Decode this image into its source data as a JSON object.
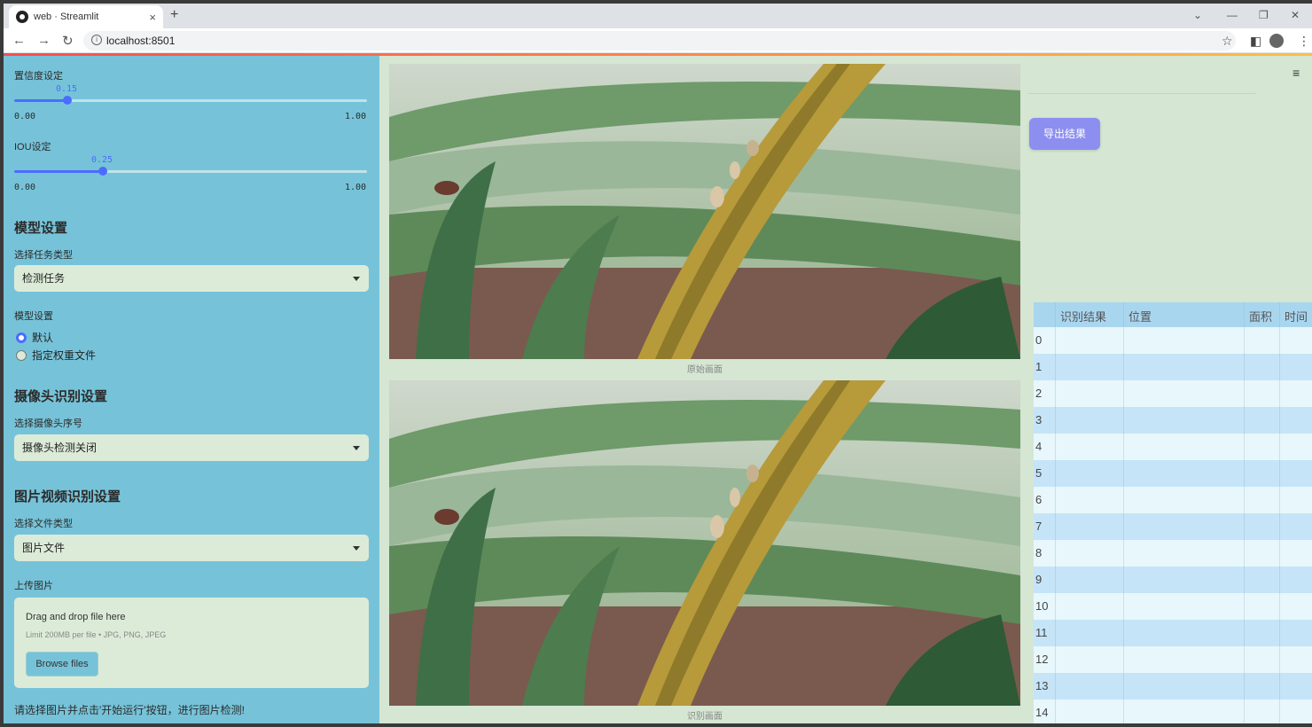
{
  "browser": {
    "tab_title": "web · Streamlit",
    "tab_close": "×",
    "new_tab": "+",
    "url": "localhost:8501",
    "minimize": "—",
    "restore": "❐",
    "close": "✕"
  },
  "sidebar": {
    "confidence_label": "置信度设定",
    "confidence_value": "0.15",
    "confidence_fraction": 0.15,
    "iou_label": "IOU设定",
    "iou_value": "0.25",
    "iou_fraction": 0.25,
    "slider_min": "0.00",
    "slider_max": "1.00",
    "model_header": "模型设置",
    "task_type_label": "选择任务类型",
    "task_type_value": "检测任务",
    "model_setting_label": "模型设置",
    "radio_default": "默认",
    "radio_custom": "指定权重文件",
    "camera_header": "摄像头识别设置",
    "camera_label": "选择摄像头序号",
    "camera_value": "摄像头检测关闭",
    "media_header": "图片视频识别设置",
    "file_type_label": "选择文件类型",
    "file_type_value": "图片文件",
    "upload_label": "上传图片",
    "upload_drag": "Drag and drop file here",
    "upload_limit": "Limit 200MB per file • JPG, PNG, JPEG",
    "browse_button": "Browse files",
    "hint": "请选择图片并点击'开始运行'按钮，进行图片检测!"
  },
  "main": {
    "caption_original": "原始画面",
    "caption_result": "识别画面"
  },
  "right": {
    "export_button": "导出结果",
    "menu_icon": "≡",
    "table_headers": [
      "识别结果",
      "位置",
      "面积",
      "时间"
    ],
    "row_indices": [
      "0",
      "1",
      "2",
      "3",
      "4",
      "5",
      "6",
      "7",
      "8",
      "9",
      "10",
      "11",
      "12",
      "13",
      "14"
    ]
  },
  "colors": {
    "sidebar_bg": "#76c3d9",
    "page_bg": "#d5e6d3",
    "accent": "#4b6cff",
    "export_button": "#8c8ff0",
    "table_header": "#a9d6ef",
    "row_even": "#e8f7fb",
    "row_odd": "#c5e4f7"
  }
}
